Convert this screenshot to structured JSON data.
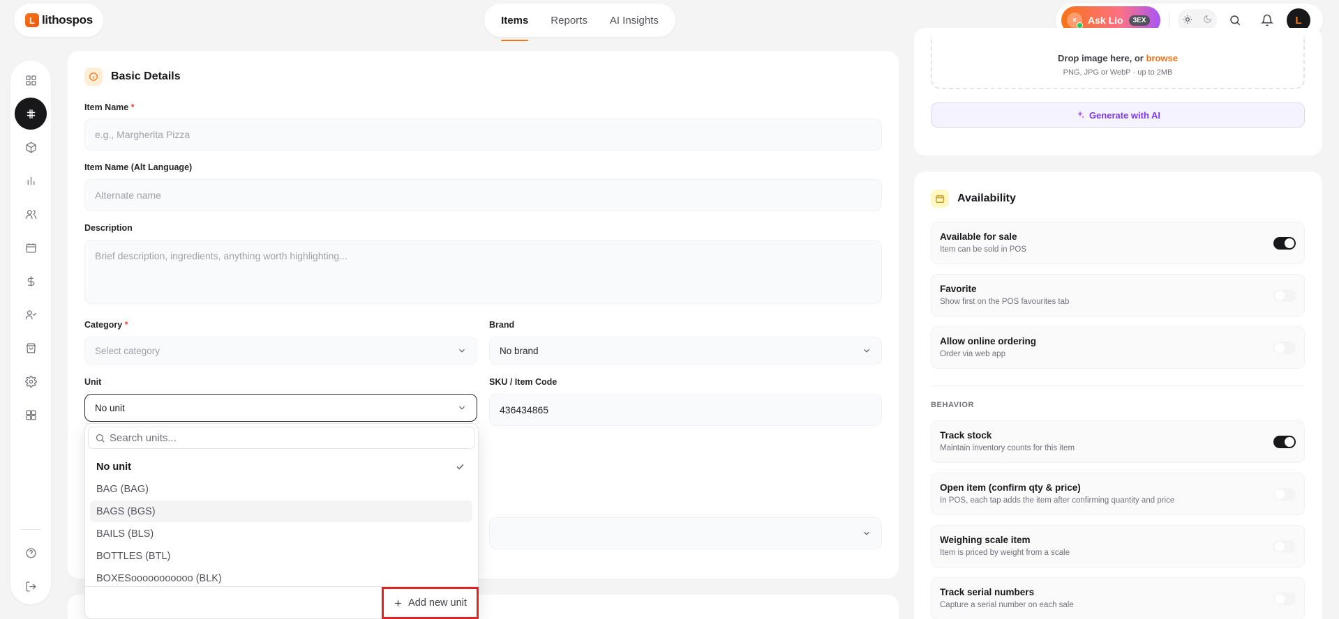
{
  "brand": {
    "logo_letter": "L",
    "name": "lithospos"
  },
  "nav": {
    "tabs": [
      {
        "label": "Items",
        "active": true
      },
      {
        "label": "Reports"
      },
      {
        "label": "AI Insights"
      }
    ]
  },
  "header": {
    "ask_label": "Ask Lio",
    "ask_icon_text": "×",
    "ask_badge": "3EX",
    "avatar_letter": "L"
  },
  "colors": {
    "accent": "#f97316",
    "dark": "#18181b",
    "ai_purple": "#7c3aed",
    "highlight_red": "#dc2626"
  },
  "sidebar": {
    "icons": [
      "dashboard-icon",
      "pos-icon",
      "box-icon",
      "chart-icon",
      "users-icon",
      "calendar-icon",
      "dollar-icon",
      "user-check-icon",
      "bag-icon",
      "settings-icon",
      "apps-icon",
      "help-icon",
      "logout-icon"
    ]
  },
  "basic": {
    "title": "Basic Details",
    "item_name": {
      "label": "Item Name",
      "required": "*",
      "placeholder": "e.g., Margherita Pizza"
    },
    "item_name_alt": {
      "label": "Item Name (Alt Language)",
      "placeholder": "Alternate name"
    },
    "description": {
      "label": "Description",
      "placeholder": "Brief description, ingredients, anything worth highlighting..."
    },
    "category": {
      "label": "Category",
      "required": "*",
      "value": "Select category"
    },
    "brand": {
      "label": "Brand",
      "value": "No brand"
    },
    "unit": {
      "label": "Unit",
      "value": "No unit"
    },
    "sku": {
      "label": "SKU / Item Code",
      "value": "436434865"
    }
  },
  "unit_dropdown": {
    "search_placeholder": "Search units...",
    "options": [
      {
        "label": "No unit",
        "selected": true
      },
      {
        "label": "BAG (BAG)"
      },
      {
        "label": "BAGS (BGS)",
        "hover": true
      },
      {
        "label": "BAILS (BLS)"
      },
      {
        "label": "BOTTLES (BTL)"
      },
      {
        "label": "BOXESooooooooooo (BLK)"
      }
    ],
    "add_label": "Add new unit"
  },
  "image": {
    "drop_text": "Drop image here, or ",
    "browse": "browse",
    "hint": "PNG, JPG or WebP · up to 2MB",
    "generate_label": "Generate with AI"
  },
  "availability": {
    "title": "Availability",
    "rows": [
      {
        "title": "Available for sale",
        "sub": "Item can be sold in POS",
        "on": true
      },
      {
        "title": "Favorite",
        "sub": "Show first on the POS favourites tab",
        "on": false
      },
      {
        "title": "Allow online ordering",
        "sub": "Order via web app",
        "on": false
      }
    ],
    "behavior_label": "BEHAVIOR",
    "behavior_rows": [
      {
        "title": "Track stock",
        "sub": "Maintain inventory counts for this item",
        "on": true
      },
      {
        "title": "Open item (confirm qty & price)",
        "sub": "In POS, each tap adds the item after confirming quantity and price",
        "on": false
      },
      {
        "title": "Weighing scale item",
        "sub": "Item is priced by weight from a scale",
        "on": false
      },
      {
        "title": "Track serial numbers",
        "sub": "Capture a serial number on each sale",
        "on": false
      }
    ]
  }
}
